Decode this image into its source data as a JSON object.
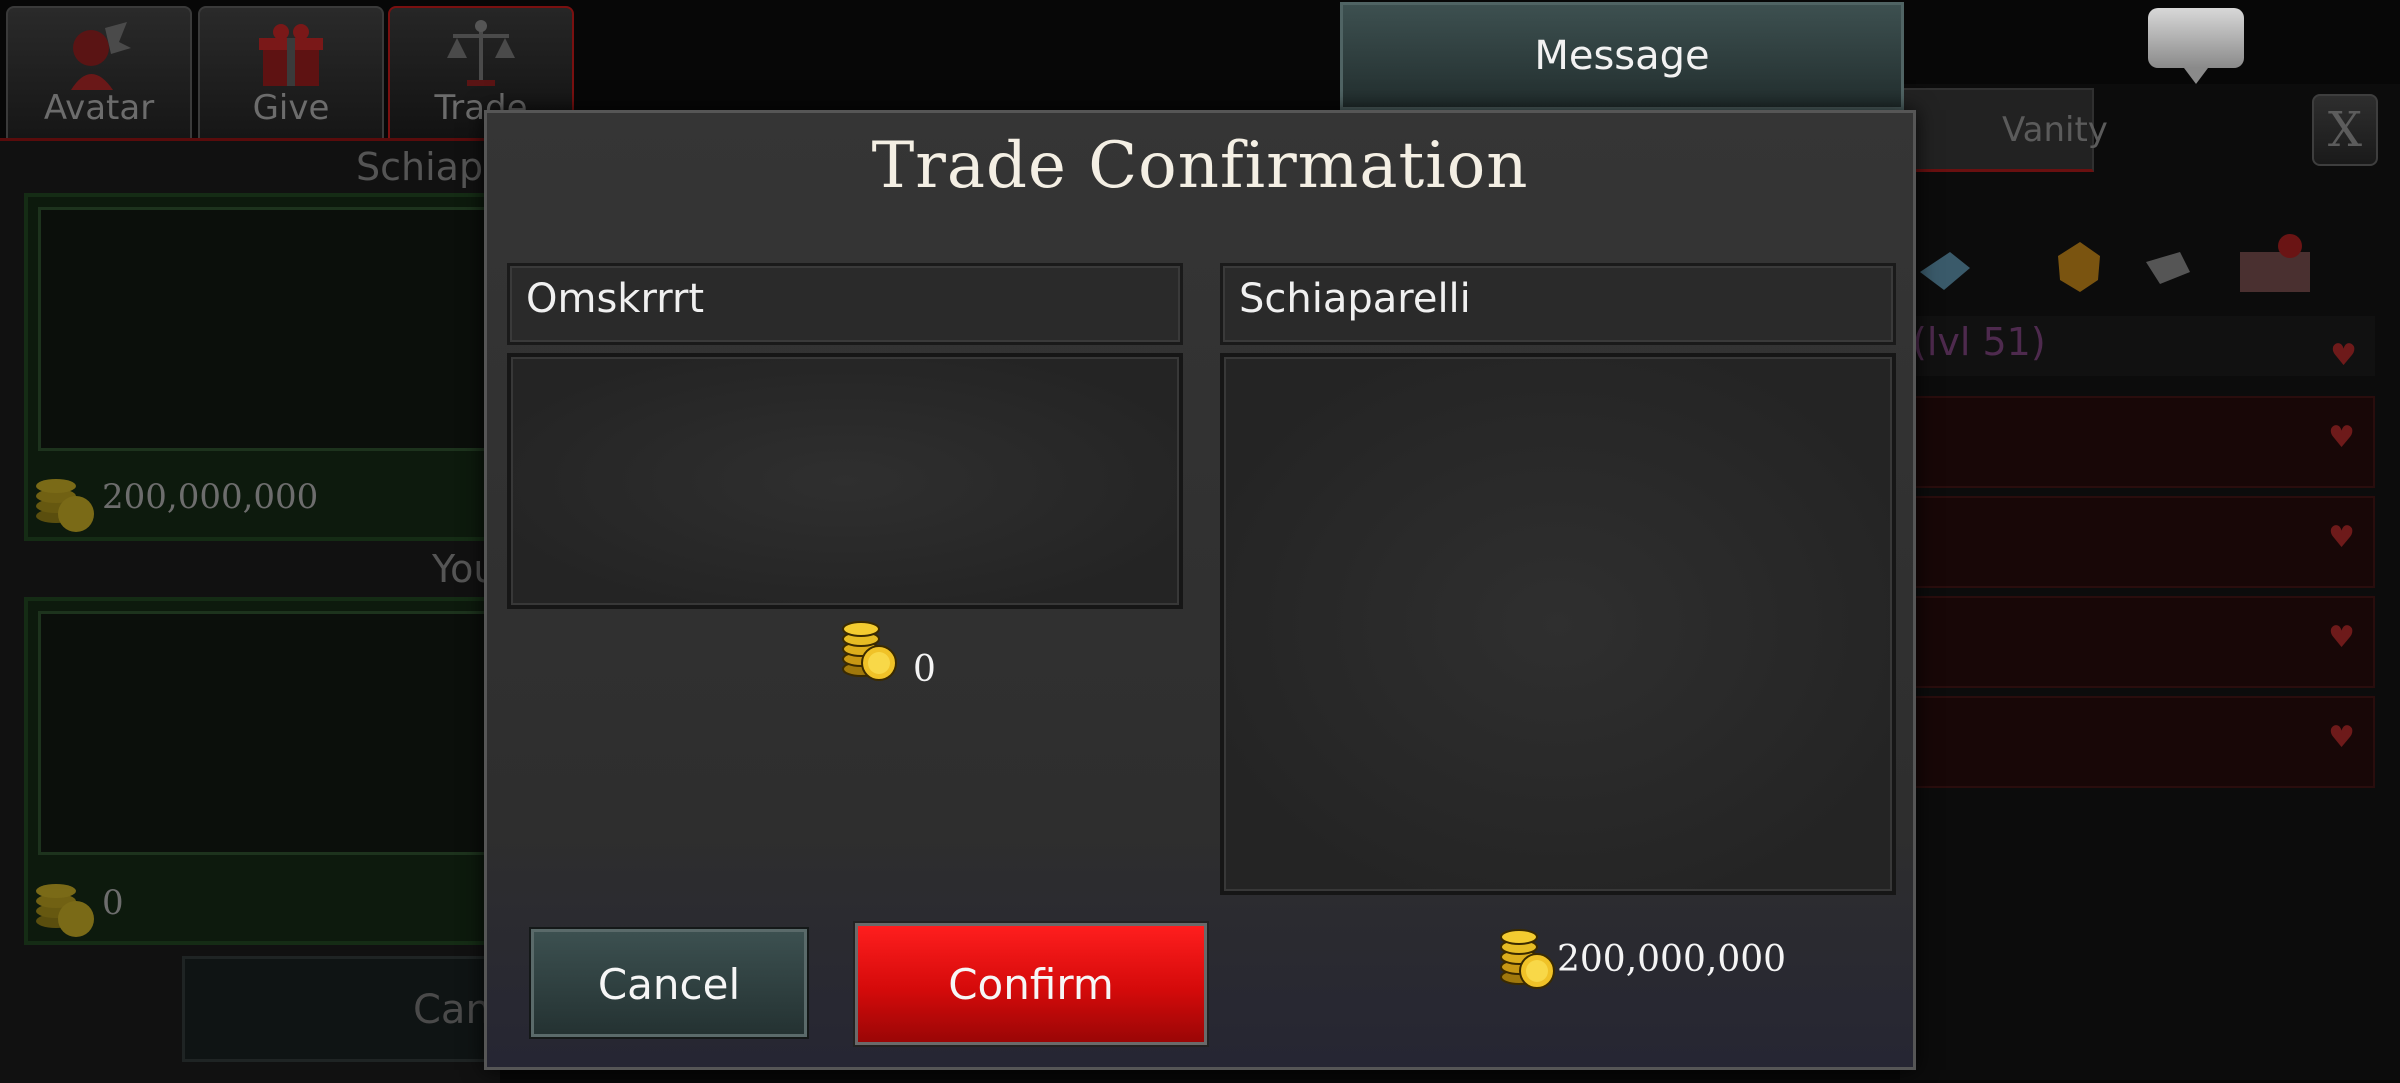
{
  "tabs": [
    {
      "label": "Avatar",
      "icon": "avatar-icon"
    },
    {
      "label": "Give",
      "icon": "gift-icon"
    },
    {
      "label": "Trade",
      "icon": "scales-icon"
    }
  ],
  "background_trade": {
    "partner_name": "Schiaparelli",
    "partner_coins": "200,000,000",
    "you_label": "You",
    "your_coins": "0",
    "cancel_label": "Cancel"
  },
  "message_button": {
    "label": "Message"
  },
  "side_panel": {
    "vanity_tab": "Vanity",
    "close_label": "X",
    "level_text": "(lvl 51)"
  },
  "modal": {
    "title": "Trade Confirmation",
    "left": {
      "name": "Omskrrrt",
      "coins": "0"
    },
    "right": {
      "name": "Schiaparelli",
      "coins": "200,000,000"
    },
    "cancel_label": "Cancel",
    "confirm_label": "Confirm"
  },
  "colors": {
    "confirm": "#e00d0d",
    "cancel": "#2f4141",
    "title": "#f4efe4"
  }
}
